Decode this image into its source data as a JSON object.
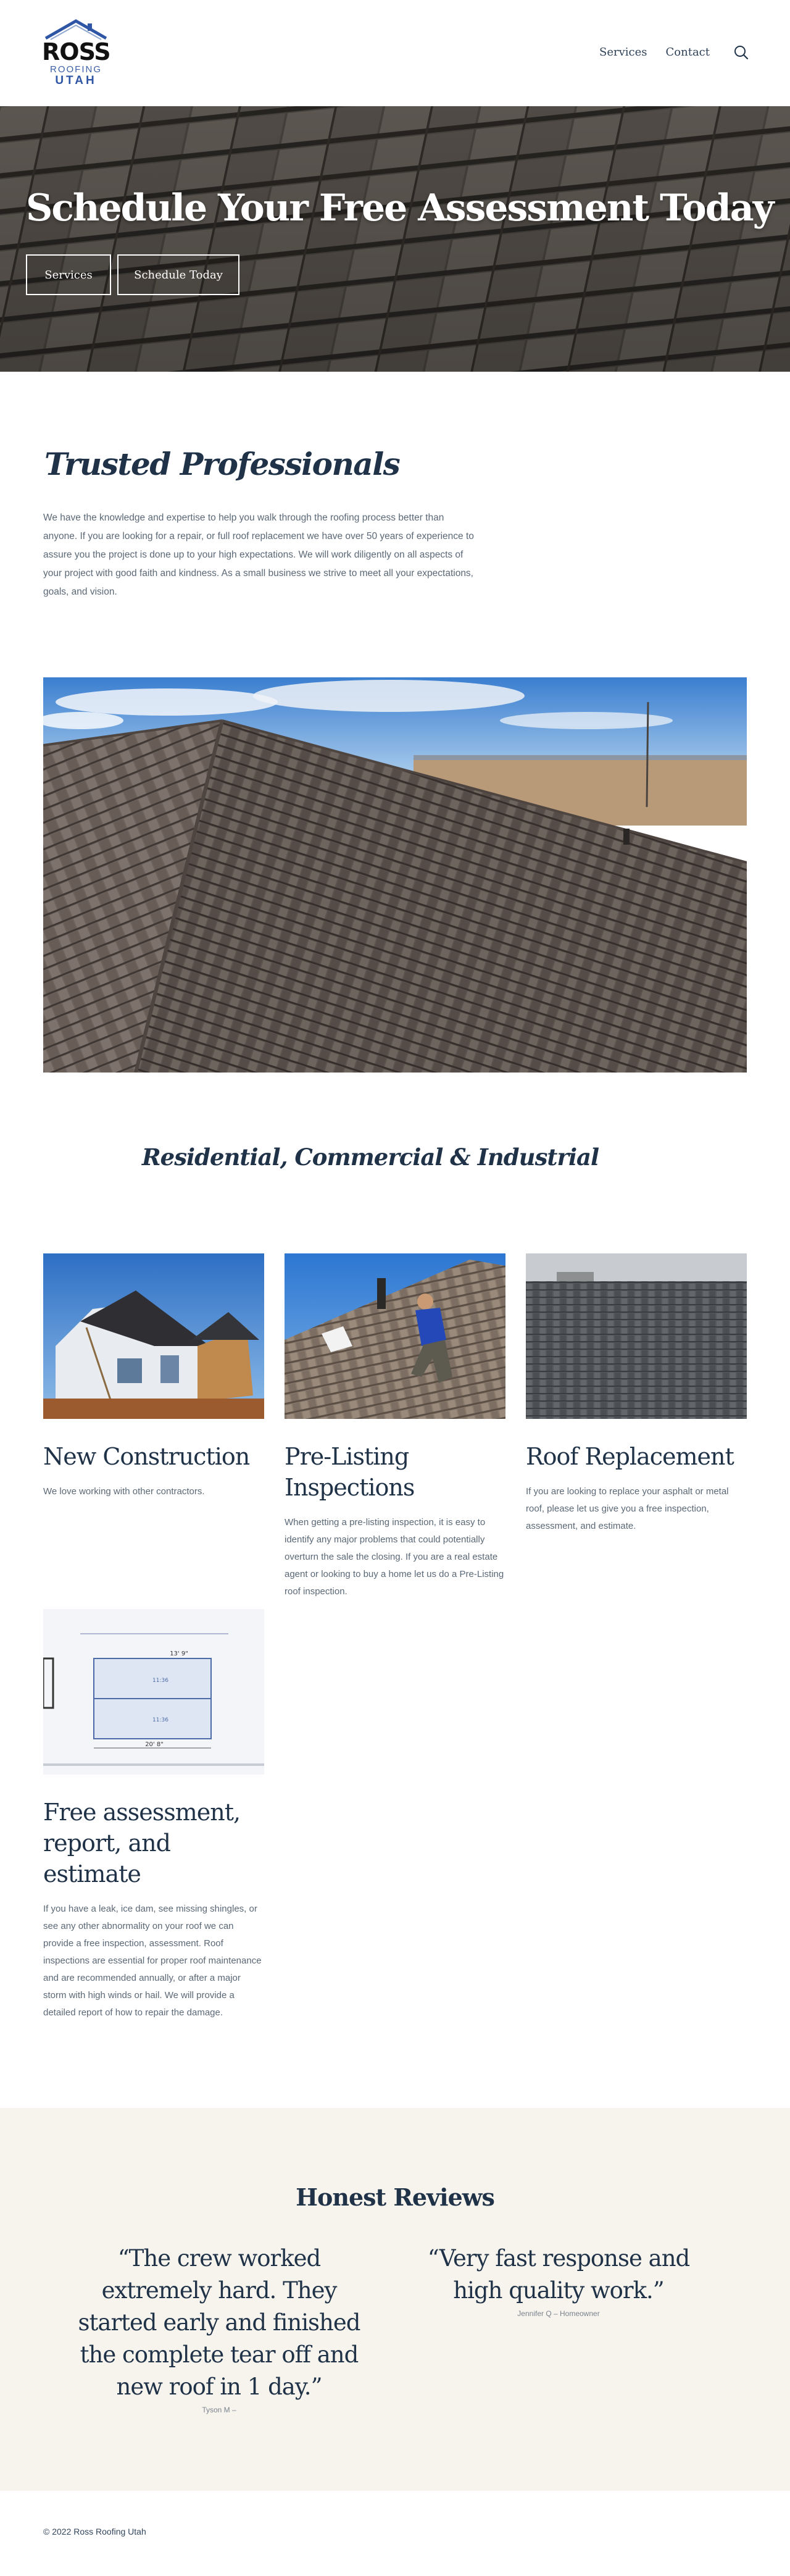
{
  "header": {
    "logo": {
      "line1": "ROSS",
      "line2": "ROOFING",
      "line3": "UTAH"
    },
    "nav": [
      {
        "label": "Services"
      },
      {
        "label": "Contact"
      }
    ]
  },
  "hero": {
    "title": "Schedule Your Free Assessment Today",
    "buttons": [
      {
        "label": "Services"
      },
      {
        "label": "Schedule Today"
      }
    ]
  },
  "intro": {
    "title": "Trusted Professionals",
    "text": "We have the knowledge and expertise to help you walk through the roofing process better than anyone. If you are looking for a repair, or full roof replacement we have over 50 years of experience to assure you the project is done up to your high expectations. We will work diligently on all aspects of your project with good faith and kindness. As a small business we strive to meet all your expectations, goals, and vision."
  },
  "residential": {
    "title": "Residential, Commercial & Industrial"
  },
  "services": [
    {
      "title": "New Construction",
      "text": "We love working with other contractors."
    },
    {
      "title": "Pre-Listing Inspections",
      "text": "When getting a pre-listing inspection, it is easy to identify any major problems that could potentially overturn the sale the closing. If you are a real estate agent or looking to buy a home let us do a Pre-Listing roof inspection."
    },
    {
      "title": "Roof Replacement",
      "text": "If you are looking to replace your asphalt or metal roof, please let us give you a free inspection, assessment, and estimate."
    },
    {
      "title": "Free assessment, report, and estimate",
      "text": "If you have a leak, ice dam, see missing shingles, or see any other abnormality on your roof we can provide a free inspection, assessment. Roof inspections are essential for proper roof maintenance and are recommended annually, or after a major storm with high winds or hail. We will provide a detailed report of how to repair the damage."
    }
  ],
  "reviews": {
    "title": "Honest Reviews",
    "items": [
      {
        "quote": "“The crew worked extremely hard. They started early and finished the complete tear off and new roof in 1 day.”",
        "author": "Tyson M –"
      },
      {
        "quote": "“Very fast response and high quality work.”",
        "author": "Jennifer Q – Homeowner"
      }
    ]
  },
  "footer": {
    "text": "© 2022  Ross Roofing Utah"
  },
  "colors": {
    "navy": "#1f3247",
    "reviews_bg": "#f7f4ee",
    "logo_blue": "#2f56a5"
  },
  "icons": {
    "search": "search-icon",
    "logo": "roof-logo-icon"
  }
}
